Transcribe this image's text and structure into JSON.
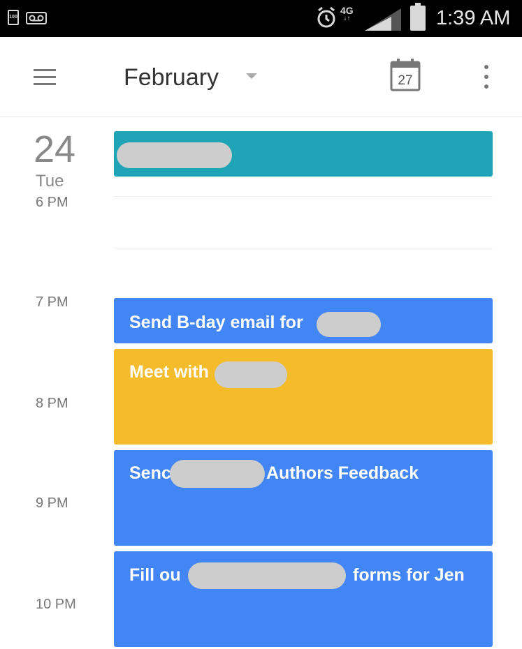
{
  "status_bar": {
    "battery_small_label": "100",
    "network": "4G",
    "time": "1:39 AM",
    "icons": [
      "battery-small-icon",
      "voicemail-icon",
      "alarm-icon",
      "network-4g-icon",
      "signal-icon",
      "battery-icon"
    ]
  },
  "app_bar": {
    "title": "February",
    "today_date": "27",
    "icons": [
      "menu-icon",
      "dropdown-caret-icon",
      "calendar-today-icon",
      "overflow-menu-icon"
    ]
  },
  "day": {
    "number": "24",
    "weekday": "Tue"
  },
  "hour_labels": [
    "6 PM",
    "7 PM",
    "8 PM",
    "9 PM",
    "10 PM"
  ],
  "events": [
    {
      "label": "Send B-day email for",
      "color": "#4285f4"
    },
    {
      "label": "Meet with",
      "color": "#f4bc2a"
    },
    {
      "label_prefix": "Senc",
      "label_suffix": "Authors Feedback",
      "color": "#4285f4"
    },
    {
      "label_prefix": "Fill ou",
      "label_suffix": "forms for Jen",
      "color": "#4285f4"
    }
  ],
  "colors": {
    "all_day_event": "#1fa4b5",
    "event_blue": "#4285f4",
    "event_yellow": "#f4bc2a",
    "redaction": "#cdcdcd"
  }
}
